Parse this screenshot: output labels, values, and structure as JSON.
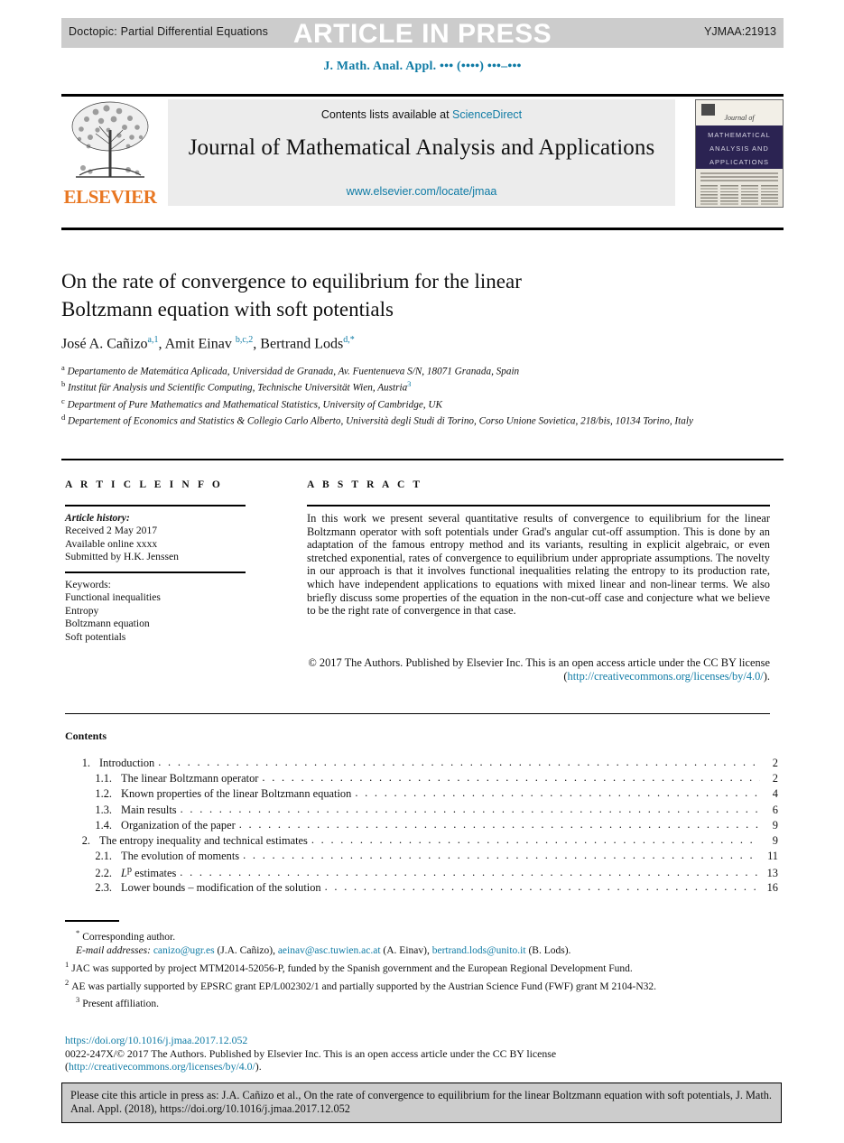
{
  "header": {
    "doctopic": "Doctopic: Partial Differential Equations",
    "watermark": "ARTICLE IN PRESS",
    "jid": "YJMAA:21913",
    "journal_citation": "J. Math. Anal. Appl. ••• (••••) •••–•••",
    "citation_color": "#0f7ba5"
  },
  "masthead": {
    "contents_prefix": "Contents lists available at ",
    "sciencedirect": "ScienceDirect",
    "journal_title": "Journal of Mathematical Analysis and Applications",
    "journal_url": "www.elsevier.com/locate/jmaa",
    "publisher_logo_text": "ELSEVIER",
    "publisher_color": "#e87722",
    "cover": {
      "journal_of": "Journal of",
      "line1": "MATHEMATICAL",
      "line2": "ANALYSIS AND",
      "line3": "APPLICATIONS",
      "band_color": "#2b2352"
    }
  },
  "article": {
    "title_line1": "On the rate of convergence to equilibrium for the linear",
    "title_line2": "Boltzmann equation with soft potentials",
    "authors": [
      {
        "name": "José A. Cañizo",
        "marks": "a,1"
      },
      {
        "name": "Amit Einav",
        "marks": "b,c,2"
      },
      {
        "name": "Bertrand Lods",
        "marks": "d,*"
      }
    ],
    "affiliations": [
      {
        "label": "a",
        "text": "Departamento de Matemática Aplicada, Universidad de Granada, Av. Fuentenueva S/N, 18071 Granada, Spain",
        "extra_mark": ""
      },
      {
        "label": "b",
        "text": "Institut für Analysis und Scientific Computing, Technische Universität Wien, Austria",
        "extra_mark": "3"
      },
      {
        "label": "c",
        "text": "Department of Pure Mathematics and Mathematical Statistics, University of Cambridge, UK",
        "extra_mark": ""
      },
      {
        "label": "d",
        "text": "Departement of Economics and Statistics & Collegio Carlo Alberto, Università degli Studi di Torino, Corso Unione Sovietica, 218/bis, 10134 Torino, Italy",
        "extra_mark": ""
      }
    ]
  },
  "info": {
    "heading": "A R T I C L E    I N F O",
    "history_label": "Article history:",
    "history": [
      "Received 2 May 2017",
      "Available online xxxx",
      "Submitted by H.K. Jenssen"
    ],
    "keywords_label": "Keywords:",
    "keywords": [
      "Functional inequalities",
      "Entropy",
      "Boltzmann equation",
      "Soft potentials"
    ]
  },
  "abstract": {
    "heading": "A B S T R A C T",
    "body": "In this work we present several quantitative results of convergence to equilibrium for the linear Boltzmann operator with soft potentials under Grad's angular cut-off assumption. This is done by an adaptation of the famous entropy method and its variants, resulting in explicit algebraic, or even stretched exponential, rates of convergence to equilibrium under appropriate assumptions. The novelty in our approach is that it involves functional inequalities relating the entropy to its production rate, which have independent applications to equations with mixed linear and non-linear terms. We also briefly discuss some properties of the equation in the non-cut-off case and conjecture what we believe to be the right rate of convergence in that case.",
    "copyright_pre": "© 2017 The Authors. Published by Elsevier Inc. This is an open access article under the CC BY license (",
    "copyright_link": "http://creativecommons.org/licenses/by/4.0/",
    "copyright_post": ")."
  },
  "contents": {
    "label": "Contents",
    "entries": [
      {
        "num": "1.",
        "label": "Introduction",
        "page": "2",
        "sub": false
      },
      {
        "num": "1.1.",
        "label": "The linear Boltzmann operator",
        "page": "2",
        "sub": true
      },
      {
        "num": "1.2.",
        "label": "Known properties of the linear Boltzmann equation",
        "page": "4",
        "sub": true
      },
      {
        "num": "1.3.",
        "label": "Main results",
        "page": "6",
        "sub": true
      },
      {
        "num": "1.4.",
        "label": "Organization of the paper",
        "page": "9",
        "sub": true
      },
      {
        "num": "2.",
        "label": "The entropy inequality and technical estimates",
        "page": "9",
        "sub": false
      },
      {
        "num": "2.1.",
        "label": "The evolution of moments",
        "page": "11",
        "sub": true
      },
      {
        "num": "2.2.",
        "label": "L p estimates",
        "page": "13",
        "sub": true
      },
      {
        "num": "2.3.",
        "label": "Lower bounds – modification of the solution",
        "page": "16",
        "sub": true
      }
    ]
  },
  "footnotes": {
    "corresponding_mark": "*",
    "corresponding": "Corresponding author.",
    "emails_label": "E-mail addresses:",
    "emails": [
      {
        "address": "canizo@ugr.es",
        "who": "(J.A. Cañizo),"
      },
      {
        "address": "aeinav@asc.tuwien.ac.at",
        "who": "(A. Einav),"
      },
      {
        "address": "bertrand.lods@unito.it",
        "who": "(B. Lods)."
      }
    ],
    "note1_mark": "1",
    "note1": "JAC was supported by project MTM2014-52056-P, funded by the Spanish government and the European Regional Development Fund.",
    "note2_mark": "2",
    "note2": "AE was partially supported by EPSRC grant EP/L002302/1 and partially supported by the Austrian Science Fund (FWF) grant M 2104-N32.",
    "note3_mark": "3",
    "note3": "Present affiliation."
  },
  "license": {
    "doi": "https://doi.org/10.1016/j.jmaa.2017.12.052",
    "line1": "0022-247X/© 2017 The Authors. Published by Elsevier Inc. This is an open access article under the CC BY license",
    "cc_open": "(",
    "cc_link": "http://creativecommons.org/licenses/by/4.0/",
    "cc_close": ")."
  },
  "cite_box": {
    "text": "Please cite this article in press as: J.A. Cañizo et al., On the rate of convergence to equilibrium for the linear Boltzmann equation with soft potentials, J. Math. Anal. Appl. (2018), https://doi.org/10.1016/j.jmaa.2017.12.052"
  }
}
